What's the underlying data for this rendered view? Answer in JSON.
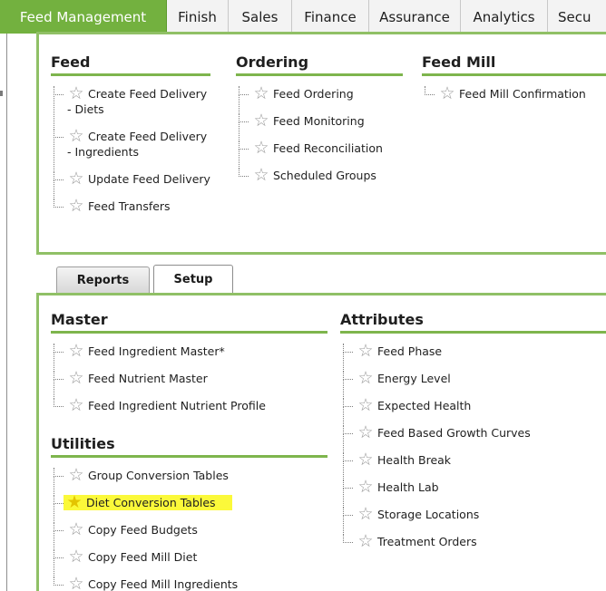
{
  "topnav": {
    "tabs": [
      {
        "label": "Feed Management",
        "active": true
      },
      {
        "label": "Finish"
      },
      {
        "label": "Sales"
      },
      {
        "label": "Finance"
      },
      {
        "label": "Assurance"
      },
      {
        "label": "Analytics"
      },
      {
        "label": "Secu"
      }
    ]
  },
  "top_panel": {
    "feed": {
      "title": "Feed",
      "items": [
        "Create Feed Delivery - Diets",
        "Create Feed Delivery - Ingredients",
        "Update Feed Delivery",
        "Feed Transfers"
      ]
    },
    "ordering": {
      "title": "Ordering",
      "items": [
        "Feed Ordering",
        "Feed Monitoring",
        "Feed Reconciliation",
        "Scheduled Groups"
      ]
    },
    "feed_mill": {
      "title": "Feed Mill",
      "items": [
        "Feed Mill Confirmation"
      ]
    }
  },
  "subtabs": {
    "reports": "Reports",
    "setup": "Setup"
  },
  "bottom_panel": {
    "master": {
      "title": "Master",
      "items": [
        "Feed Ingredient Master*",
        "Feed Nutrient Master",
        "Feed Ingredient Nutrient Profile"
      ]
    },
    "utilities": {
      "title": "Utilities",
      "items": [
        "Group Conversion Tables",
        "Diet Conversion Tables",
        "Copy Feed Budgets",
        "Copy Feed Mill Diet",
        "Copy Feed Mill Ingredients"
      ]
    },
    "attributes": {
      "title": "Attributes",
      "items": [
        "Feed Phase",
        "Energy Level",
        "Expected Health",
        "Feed Based Growth Curves",
        "Health Break",
        "Health Lab",
        "Storage Locations",
        "Treatment Orders"
      ]
    }
  },
  "icons": {
    "favorite": "star-outline-icon",
    "favorite_active": "star-filled-icon"
  },
  "colors": {
    "accent": "#73b13f",
    "panel_border": "#90c066",
    "highlight": "#fbf93a",
    "star_active": "#e3c400"
  }
}
